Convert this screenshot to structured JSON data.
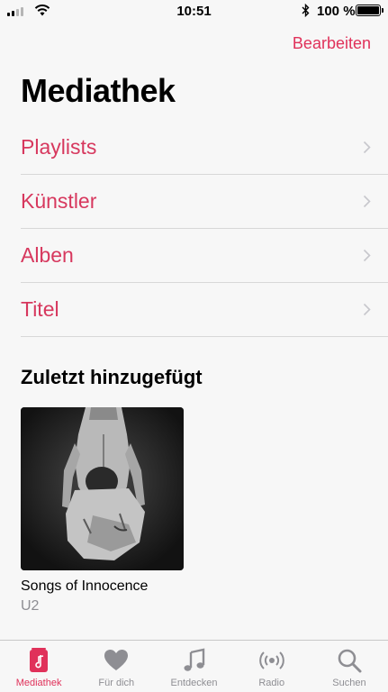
{
  "status_bar": {
    "time": "10:51",
    "battery_percent": "100 %",
    "signal_bars": 2
  },
  "header": {
    "edit_label": "Bearbeiten",
    "title": "Mediathek"
  },
  "library_items": [
    {
      "label": "Playlists"
    },
    {
      "label": "Künstler"
    },
    {
      "label": "Alben"
    },
    {
      "label": "Titel"
    }
  ],
  "recent": {
    "section_title": "Zuletzt hinzugefügt",
    "albums": [
      {
        "title": "Songs of Innocence",
        "artist": "U2"
      }
    ]
  },
  "tab_bar": {
    "tabs": [
      {
        "label": "Mediathek",
        "icon": "library-icon",
        "active": true
      },
      {
        "label": "Für dich",
        "icon": "heart-icon",
        "active": false
      },
      {
        "label": "Entdecken",
        "icon": "music-note-icon",
        "active": false
      },
      {
        "label": "Radio",
        "icon": "radio-icon",
        "active": false
      },
      {
        "label": "Suchen",
        "icon": "search-icon",
        "active": false
      }
    ]
  },
  "colors": {
    "accent": "#e0315a",
    "list_text": "#d7385e",
    "secondary_text": "#8e8e93",
    "background": "#f7f7f7"
  }
}
